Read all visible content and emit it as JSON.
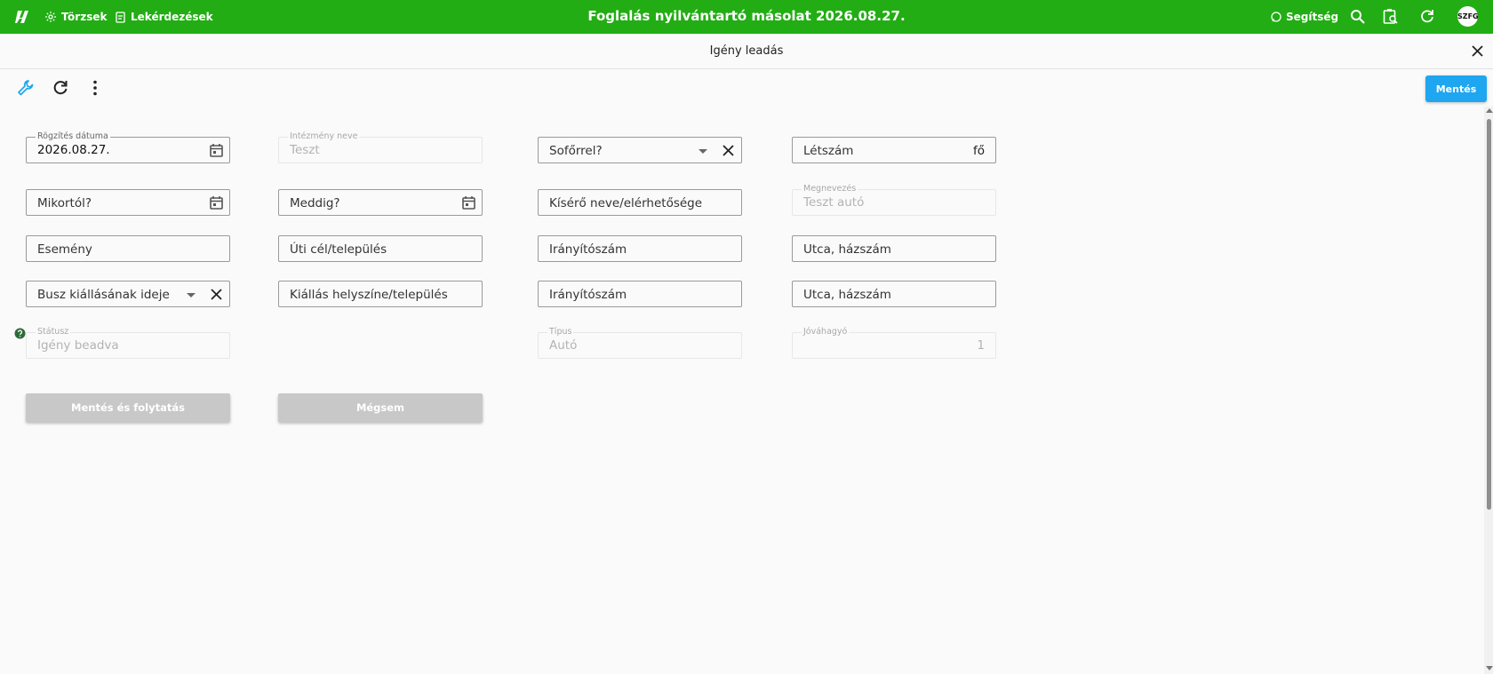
{
  "topbar": {
    "nav": [
      {
        "label": "Törzsek",
        "icon": "sun-icon"
      },
      {
        "label": "Lekérdezések",
        "icon": "report-icon"
      }
    ],
    "title": "Foglalás nyilvántartó másolat 2026.08.27.",
    "help_label": "Segítség",
    "avatar": "SZFG",
    "bg_color": "#22ad14"
  },
  "dialog": {
    "title": "Igény leadás"
  },
  "toolbar": {
    "save_label": "Mentés",
    "save_color": "#1ea6f0",
    "icons": [
      "wrench-icon",
      "refresh-icon",
      "more-vert-icon"
    ]
  },
  "form": {
    "rogzites_datuma": {
      "label": "Rögzítés dátuma",
      "value": "2026.08.27."
    },
    "intezmeny_neve": {
      "label": "Intézmény neve",
      "value": "Teszt"
    },
    "soforrel": {
      "placeholder": "Sofőrrel?"
    },
    "letszam": {
      "placeholder": "Létszám",
      "suffix": "fő"
    },
    "mikortol": {
      "placeholder": "Mikortól?"
    },
    "meddig": {
      "placeholder": "Meddig?"
    },
    "kisero": {
      "placeholder": "Kísérő neve/elérhetősége"
    },
    "megnevezes": {
      "label": "Megnevezés",
      "value": "Teszt autó"
    },
    "esemeny": {
      "placeholder": "Esemény"
    },
    "uti_cel": {
      "placeholder": "Úti cél/település"
    },
    "iranyitoszam1": {
      "placeholder": "Irányítószám"
    },
    "utca1": {
      "placeholder": "Utca, házszám"
    },
    "busz_kiallas": {
      "placeholder": "Busz kiállásának ideje"
    },
    "kiallas_helyszine": {
      "placeholder": "Kiállás helyszíne/település"
    },
    "iranyitoszam2": {
      "placeholder": "Irányítószám"
    },
    "utca2": {
      "placeholder": "Utca, házszám"
    },
    "statusz": {
      "label": "Státusz",
      "value": "Igény beadva"
    },
    "tipus": {
      "label": "Típus",
      "value": "Autó"
    },
    "jovahagyo": {
      "label": "Jóváhagyó",
      "value": "1"
    }
  },
  "buttons": {
    "save_continue": "Mentés és folytatás",
    "cancel": "Mégsem"
  }
}
